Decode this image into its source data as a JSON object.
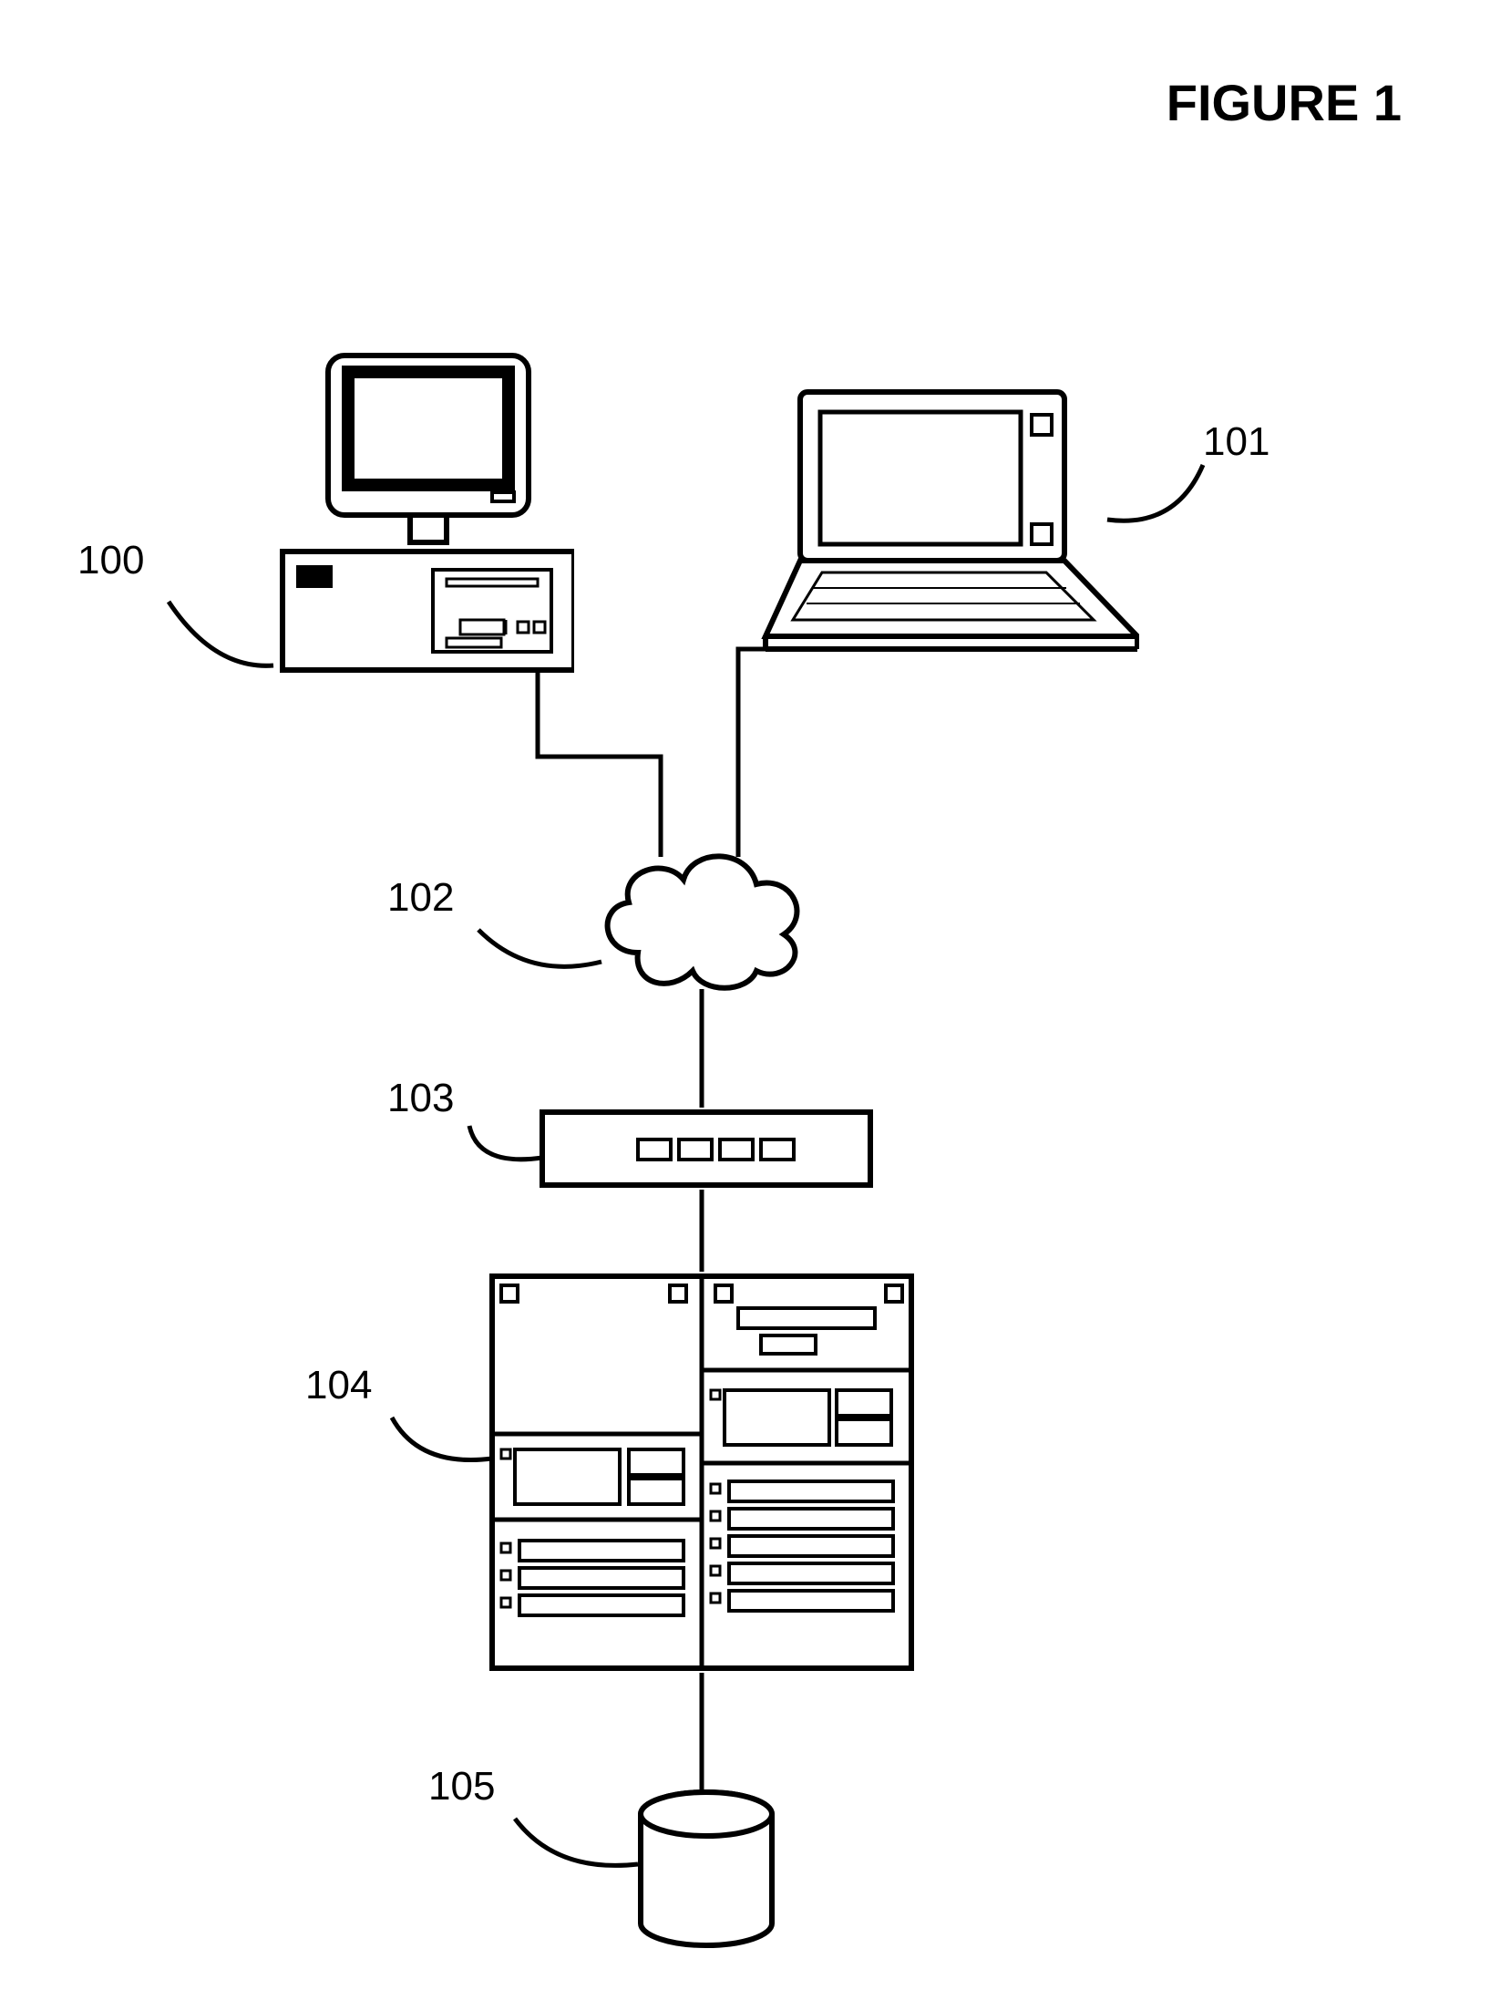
{
  "title": "FIGURE 1",
  "labels": {
    "desktop": "100",
    "laptop": "101",
    "cloud": "102",
    "router": "103",
    "servers": "104",
    "database": "105"
  }
}
